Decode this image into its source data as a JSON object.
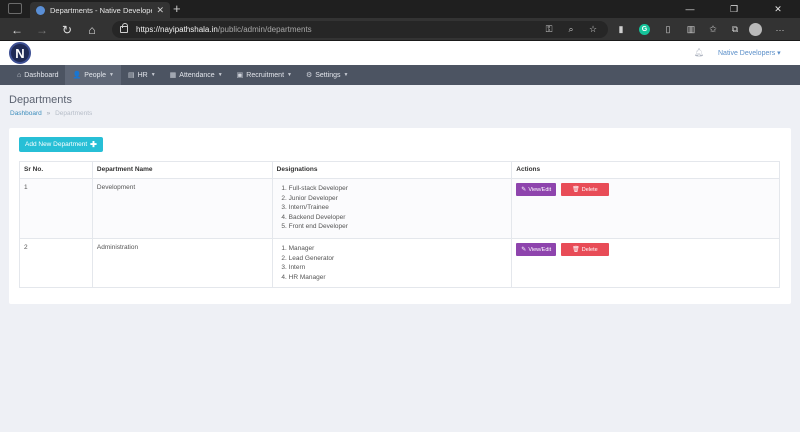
{
  "browser": {
    "tab_title": "Departments - Native Developer",
    "url_host": "https://nayipathshala.in",
    "url_path": "/public/admin/departments"
  },
  "header": {
    "logo_letter": "N",
    "user_label": "Native Developers ▾"
  },
  "nav": {
    "items": [
      {
        "icon": "⌂",
        "label": "Dashboard",
        "caret": ""
      },
      {
        "icon": "👤",
        "label": "People",
        "caret": "▼"
      },
      {
        "icon": "▤",
        "label": "HR",
        "caret": "▼"
      },
      {
        "icon": "▦",
        "label": "Attendance",
        "caret": "▼"
      },
      {
        "icon": "▣",
        "label": "Recruitment",
        "caret": "▼"
      },
      {
        "icon": "⚙",
        "label": "Settings",
        "caret": "▼"
      }
    ]
  },
  "page": {
    "title": "Departments",
    "breadcrumb_home": "Dashboard",
    "breadcrumb_sep": "»",
    "breadcrumb_current": "Departments",
    "add_button": "Add New Department",
    "add_button_icon": "✚"
  },
  "table": {
    "headers": [
      "Sr No.",
      "Department Name",
      "Designations",
      "Actions"
    ],
    "edit_label": "View/Edit",
    "delete_label": "Delete",
    "rows": [
      {
        "sr": "1",
        "name": "Development",
        "designations": [
          "Full-stack Developer",
          "Junior Developer",
          "Intern/Trainee",
          "Backend Developer",
          "Front end Developer"
        ]
      },
      {
        "sr": "2",
        "name": "Administration",
        "designations": [
          "Manager",
          "Lead Generator",
          "Intern",
          "HR Manager"
        ]
      }
    ]
  }
}
